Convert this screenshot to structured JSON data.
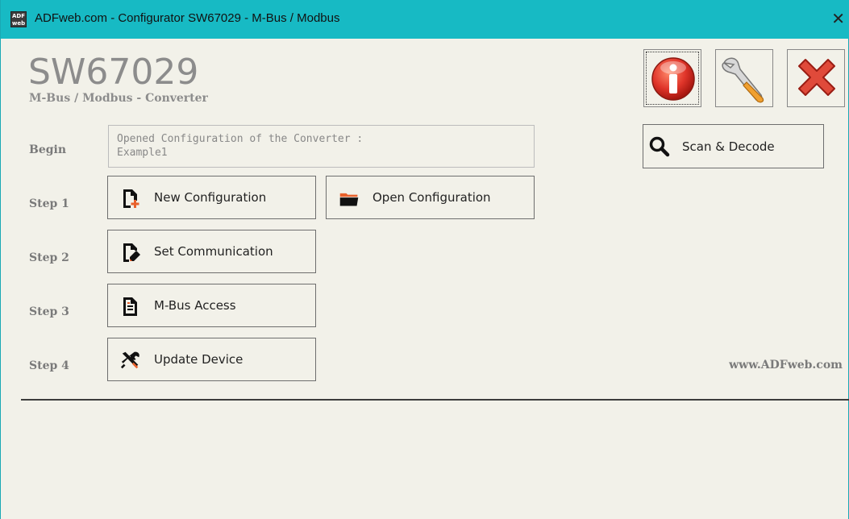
{
  "window": {
    "title": "ADFweb.com - Configurator SW67029 - M-Bus / Modbus",
    "app_icon_text": "ADF web",
    "close_glyph": "✕"
  },
  "header": {
    "product": "SW67029",
    "subtitle": "M-Bus / Modbus - Converter"
  },
  "status": {
    "line1": "Opened Configuration of the Converter :",
    "line2": "Example1"
  },
  "steps": {
    "begin": "Begin",
    "step1": "Step 1",
    "step2": "Step 2",
    "step3": "Step 3",
    "step4": "Step 4"
  },
  "buttons": {
    "new_config": "New Configuration",
    "open_config": "Open Configuration",
    "set_comm": "Set Communication",
    "mbus_access": "M-Bus Access",
    "update_device": "Update Device",
    "scan_decode": "Scan & Decode"
  },
  "toolbar_icons": [
    "info-icon",
    "wrench-icon",
    "close-red-x-icon"
  ],
  "footer": {
    "website": "www.ADFweb.com"
  },
  "colors": {
    "titlebar": "#17bac4",
    "background": "#f2f1e9",
    "accent_orange": "#e8612c",
    "info_red": "#d9362a"
  }
}
